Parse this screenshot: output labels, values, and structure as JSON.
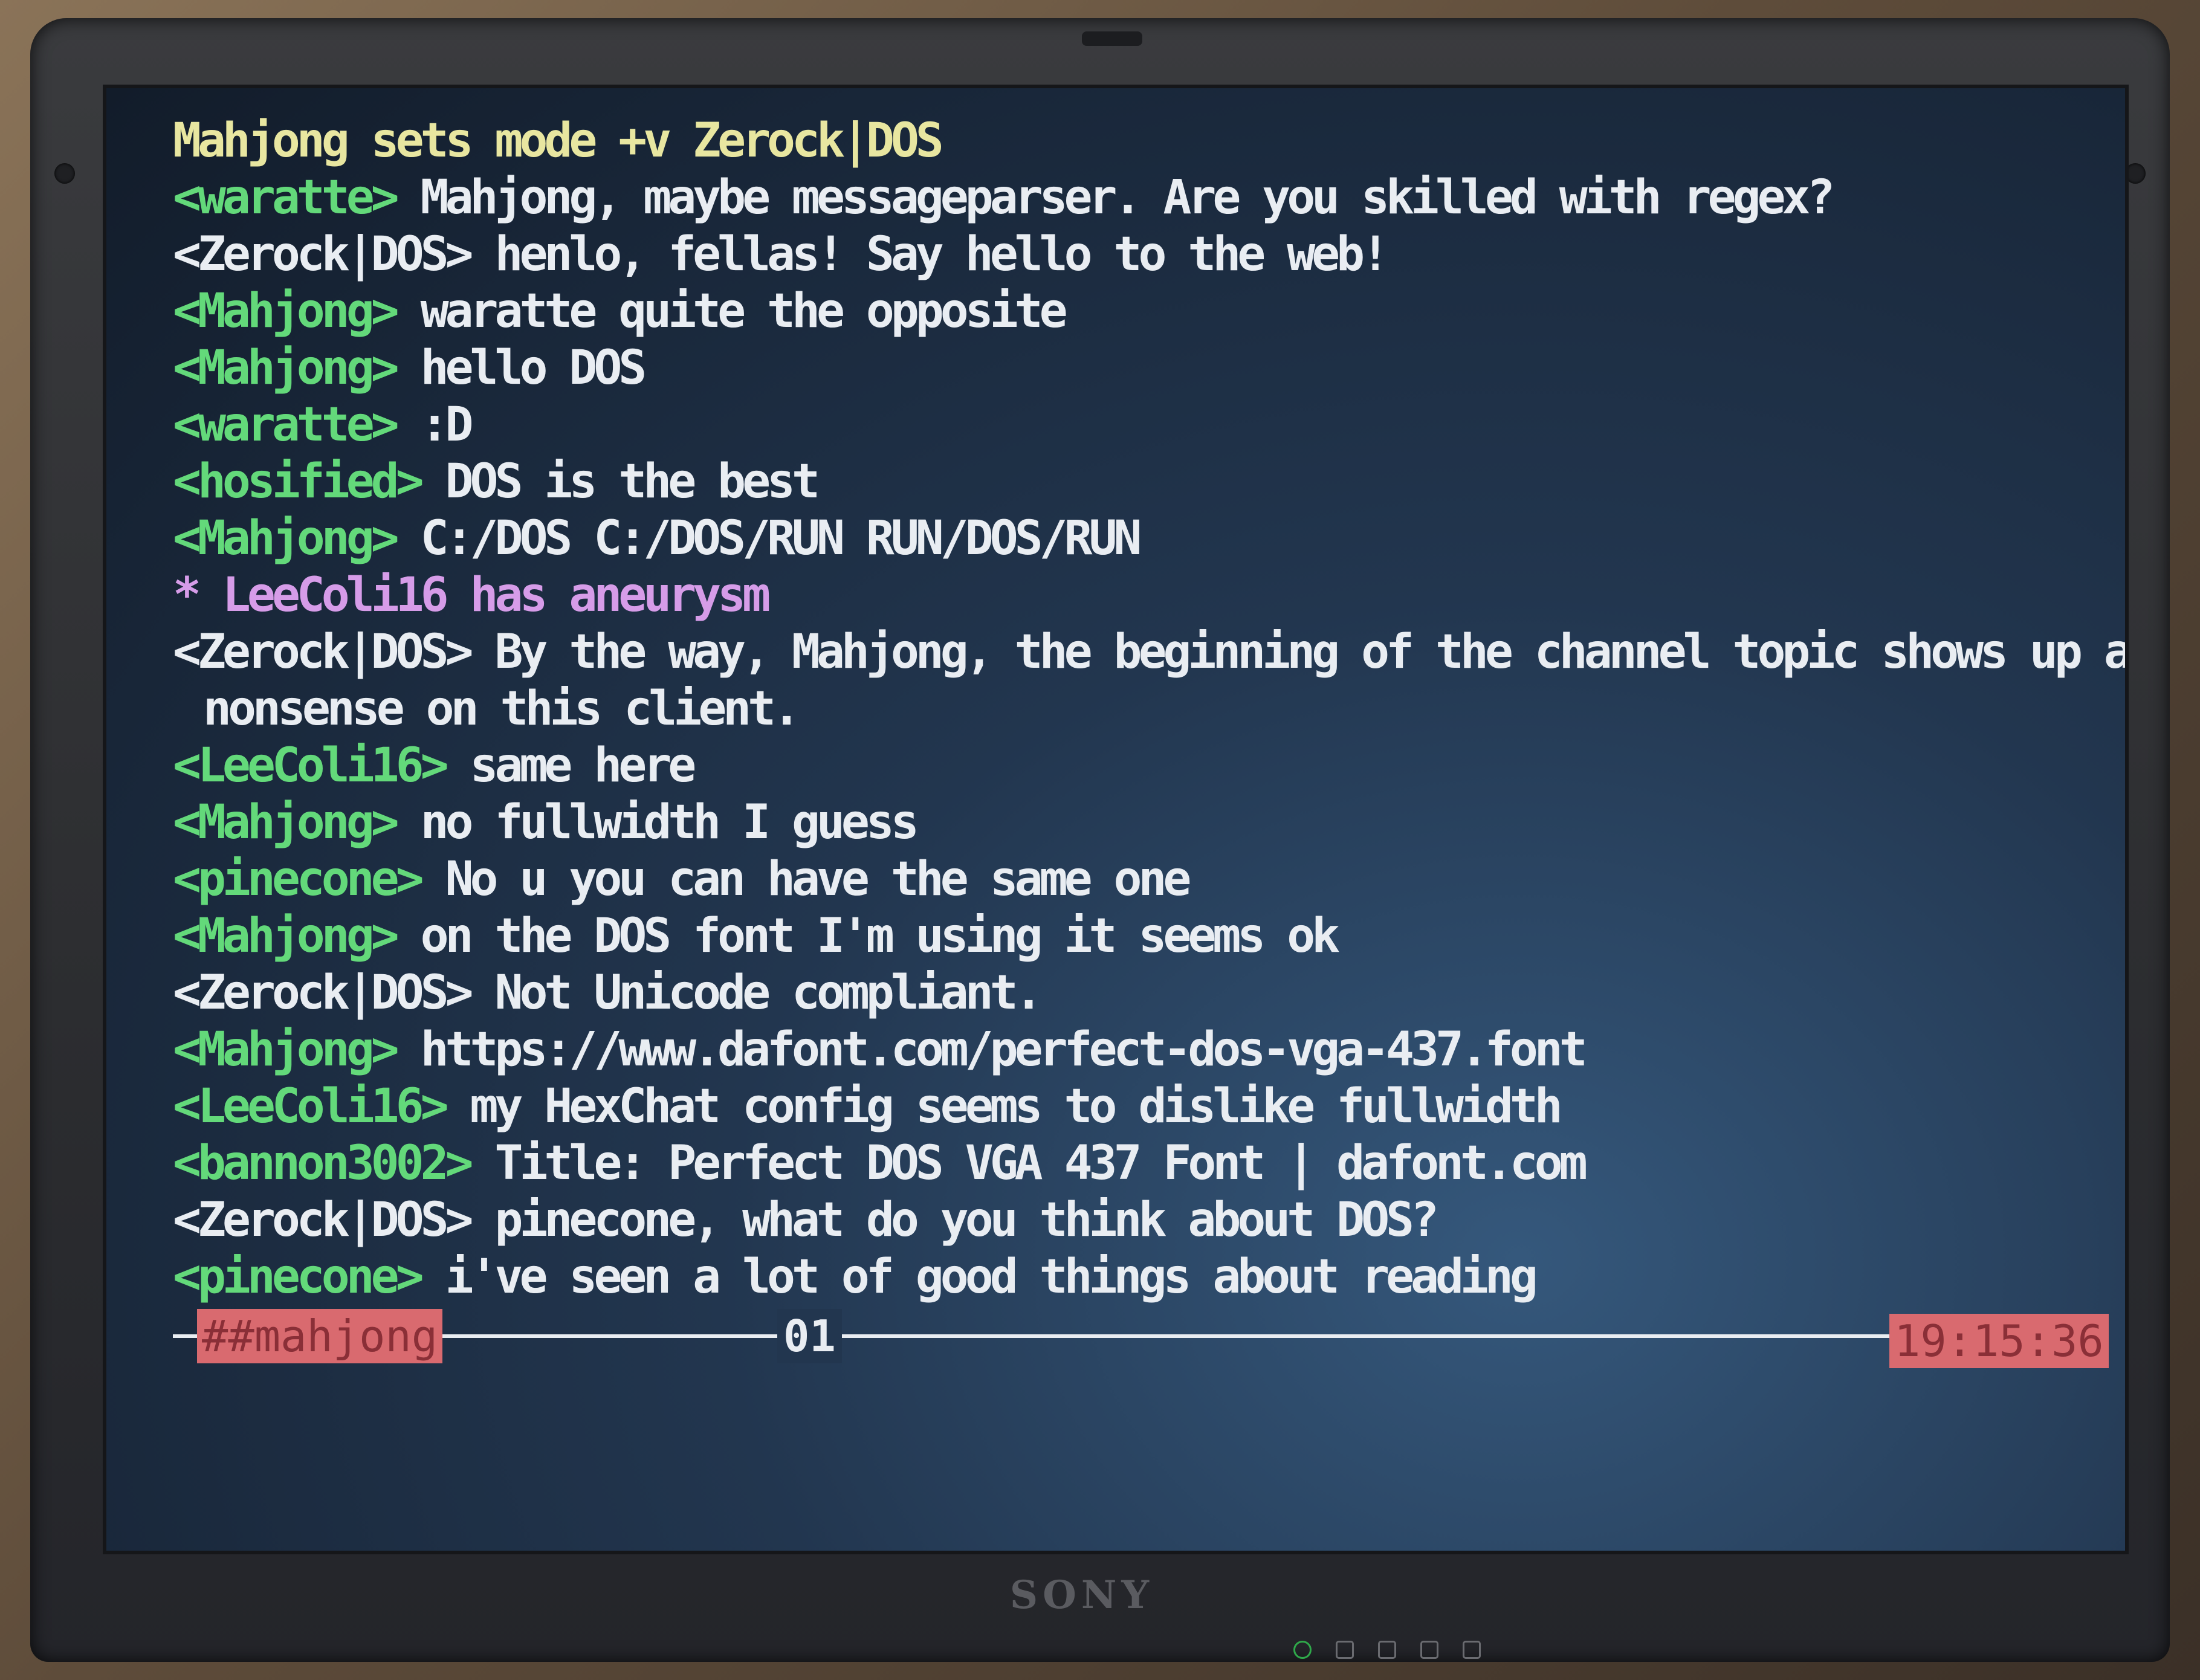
{
  "device": {
    "brand": "SONY"
  },
  "chat": {
    "lines": [
      {
        "kind": "mode",
        "text": "Mahjong sets mode +v Zerock|DOS"
      },
      {
        "kind": "msg",
        "nick": "<waratte>",
        "text": " Mahjong, maybe messageparser. Are you skilled with regex?"
      },
      {
        "kind": "msg",
        "nick": "<Zerock|DOS>",
        "text": " henlo, fellas! Say hello to the web!",
        "nick_color": "#e9edf2"
      },
      {
        "kind": "msg",
        "nick": "<Mahjong>",
        "text": " waratte quite the opposite"
      },
      {
        "kind": "msg",
        "nick": "<Mahjong>",
        "text": " hello DOS"
      },
      {
        "kind": "msg",
        "nick": "<waratte>",
        "text": " :D"
      },
      {
        "kind": "msg",
        "nick": "<hosified>",
        "text": " DOS is the best"
      },
      {
        "kind": "msg",
        "nick": "<Mahjong>",
        "text": " C:/DOS C:/DOS/RUN RUN/DOS/RUN"
      },
      {
        "kind": "action",
        "text": "* LeeColi16 has aneurysm"
      },
      {
        "kind": "msg",
        "nick": "<Zerock|DOS>",
        "text": " By the way, Mahjong, the beginning of the channel topic shows up as",
        "nick_color": "#e9edf2"
      },
      {
        "kind": "cont",
        "text": "nonsense on this client."
      },
      {
        "kind": "msg",
        "nick": "<LeeColi16>",
        "text": " same here"
      },
      {
        "kind": "msg",
        "nick": "<Mahjong>",
        "text": " no fullwidth I guess"
      },
      {
        "kind": "msg",
        "nick": "<pinecone>",
        "text": " No u you can have the same one"
      },
      {
        "kind": "msg",
        "nick": "<Mahjong>",
        "text": " on the DOS font I'm using it seems ok"
      },
      {
        "kind": "msg",
        "nick": "<Zerock|DOS>",
        "text": " Not Unicode compliant.",
        "nick_color": "#e9edf2"
      },
      {
        "kind": "msg",
        "nick": "<Mahjong>",
        "text": " https://www.dafont.com/perfect-dos-vga-437.font"
      },
      {
        "kind": "msg",
        "nick": "<LeeColi16>",
        "text": " my HexChat config seems to dislike fullwidth"
      },
      {
        "kind": "msg",
        "nick": "<bannon3002>",
        "text": " Title: Perfect DOS VGA 437 Font | dafont.com"
      },
      {
        "kind": "msg",
        "nick": "<Zerock|DOS>",
        "text": " pinecone, what do you think about DOS?",
        "nick_color": "#e9edf2"
      },
      {
        "kind": "msg",
        "nick": "<pinecone>",
        "text": " i've seen a lot of good things about reading"
      }
    ]
  },
  "status": {
    "channel": "##mahjong",
    "window": "01",
    "clock": "19:15:36"
  },
  "colors": {
    "nick": "#63d97a",
    "text": "#e9edf2",
    "mode": "#e8e6a0",
    "action": "#d69ce8",
    "highlight_bg": "#d96a6f"
  },
  "icons": [
    "power-led-icon",
    "caps-lock-icon",
    "num-lock-icon",
    "scroll-lock-icon",
    "disk-activity-icon"
  ]
}
